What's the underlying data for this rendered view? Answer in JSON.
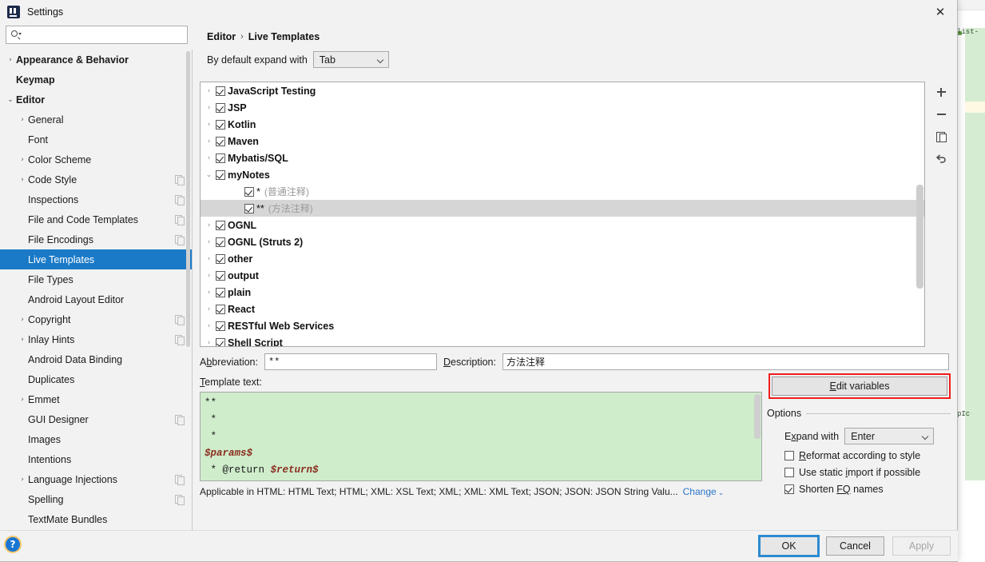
{
  "dialog": {
    "title": "Settings",
    "app_icon": "intellij-idea-icon",
    "close_icon": "✕"
  },
  "search": {
    "value": "",
    "placeholder": ""
  },
  "sidebar": {
    "items": [
      {
        "label": "Appearance & Behavior",
        "arrow": "›",
        "bold": true,
        "indent": 0,
        "selected": false,
        "copy": false
      },
      {
        "label": "Keymap",
        "arrow": "",
        "bold": true,
        "indent": 0,
        "selected": false,
        "copy": false
      },
      {
        "label": "Editor",
        "arrow": "⌄",
        "bold": true,
        "indent": 0,
        "selected": false,
        "copy": false
      },
      {
        "label": "General",
        "arrow": "›",
        "bold": false,
        "indent": 1,
        "selected": false,
        "copy": false
      },
      {
        "label": "Font",
        "arrow": "",
        "bold": false,
        "indent": 1,
        "selected": false,
        "copy": false
      },
      {
        "label": "Color Scheme",
        "arrow": "›",
        "bold": false,
        "indent": 1,
        "selected": false,
        "copy": false
      },
      {
        "label": "Code Style",
        "arrow": "›",
        "bold": false,
        "indent": 1,
        "selected": false,
        "copy": true
      },
      {
        "label": "Inspections",
        "arrow": "",
        "bold": false,
        "indent": 1,
        "selected": false,
        "copy": true
      },
      {
        "label": "File and Code Templates",
        "arrow": "",
        "bold": false,
        "indent": 1,
        "selected": false,
        "copy": true
      },
      {
        "label": "File Encodings",
        "arrow": "",
        "bold": false,
        "indent": 1,
        "selected": false,
        "copy": true
      },
      {
        "label": "Live Templates",
        "arrow": "",
        "bold": false,
        "indent": 1,
        "selected": true,
        "copy": false
      },
      {
        "label": "File Types",
        "arrow": "",
        "bold": false,
        "indent": 1,
        "selected": false,
        "copy": false
      },
      {
        "label": "Android Layout Editor",
        "arrow": "",
        "bold": false,
        "indent": 1,
        "selected": false,
        "copy": false
      },
      {
        "label": "Copyright",
        "arrow": "›",
        "bold": false,
        "indent": 1,
        "selected": false,
        "copy": true
      },
      {
        "label": "Inlay Hints",
        "arrow": "›",
        "bold": false,
        "indent": 1,
        "selected": false,
        "copy": true
      },
      {
        "label": "Android Data Binding",
        "arrow": "",
        "bold": false,
        "indent": 1,
        "selected": false,
        "copy": false
      },
      {
        "label": "Duplicates",
        "arrow": "",
        "bold": false,
        "indent": 1,
        "selected": false,
        "copy": false
      },
      {
        "label": "Emmet",
        "arrow": "›",
        "bold": false,
        "indent": 1,
        "selected": false,
        "copy": false
      },
      {
        "label": "GUI Designer",
        "arrow": "",
        "bold": false,
        "indent": 1,
        "selected": false,
        "copy": true
      },
      {
        "label": "Images",
        "arrow": "",
        "bold": false,
        "indent": 1,
        "selected": false,
        "copy": false
      },
      {
        "label": "Intentions",
        "arrow": "",
        "bold": false,
        "indent": 1,
        "selected": false,
        "copy": false
      },
      {
        "label": "Language Injections",
        "arrow": "›",
        "bold": false,
        "indent": 1,
        "selected": false,
        "copy": true
      },
      {
        "label": "Spelling",
        "arrow": "",
        "bold": false,
        "indent": 1,
        "selected": false,
        "copy": true
      },
      {
        "label": "TextMate Bundles",
        "arrow": "",
        "bold": false,
        "indent": 1,
        "selected": false,
        "copy": false
      }
    ]
  },
  "breadcrumb": {
    "parent": "Editor",
    "separator": "›",
    "current": "Live Templates"
  },
  "expand_default": {
    "label": "By default expand with",
    "value": "Tab"
  },
  "tree": {
    "rows": [
      {
        "label": "JavaScript Testing",
        "desc": "",
        "twisty": "›",
        "checked": true,
        "level": 0,
        "selected": false
      },
      {
        "label": "JSP",
        "desc": "",
        "twisty": "›",
        "checked": true,
        "level": 0,
        "selected": false
      },
      {
        "label": "Kotlin",
        "desc": "",
        "twisty": "›",
        "checked": true,
        "level": 0,
        "selected": false
      },
      {
        "label": "Maven",
        "desc": "",
        "twisty": "›",
        "checked": true,
        "level": 0,
        "selected": false
      },
      {
        "label": "Mybatis/SQL",
        "desc": "",
        "twisty": "›",
        "checked": true,
        "level": 0,
        "selected": false
      },
      {
        "label": "myNotes",
        "desc": "",
        "twisty": "⌄",
        "checked": true,
        "level": 0,
        "selected": false
      },
      {
        "label": "*",
        "desc": "(普通注释)",
        "twisty": "",
        "checked": true,
        "level": 1,
        "selected": false
      },
      {
        "label": "**",
        "desc": "(方法注释)",
        "twisty": "",
        "checked": true,
        "level": 1,
        "selected": true
      },
      {
        "label": "OGNL",
        "desc": "",
        "twisty": "›",
        "checked": true,
        "level": 0,
        "selected": false
      },
      {
        "label": "OGNL (Struts 2)",
        "desc": "",
        "twisty": "›",
        "checked": true,
        "level": 0,
        "selected": false
      },
      {
        "label": "other",
        "desc": "",
        "twisty": "›",
        "checked": true,
        "level": 0,
        "selected": false
      },
      {
        "label": "output",
        "desc": "",
        "twisty": "›",
        "checked": true,
        "level": 0,
        "selected": false
      },
      {
        "label": "plain",
        "desc": "",
        "twisty": "›",
        "checked": true,
        "level": 0,
        "selected": false
      },
      {
        "label": "React",
        "desc": "",
        "twisty": "›",
        "checked": true,
        "level": 0,
        "selected": false
      },
      {
        "label": "RESTful Web Services",
        "desc": "",
        "twisty": "›",
        "checked": true,
        "level": 0,
        "selected": false
      },
      {
        "label": "Shell Script",
        "desc": "",
        "twisty": "›",
        "checked": true,
        "level": 0,
        "selected": false
      }
    ]
  },
  "tree_tools": [
    {
      "name": "add-template-button",
      "icon": "plus-icon"
    },
    {
      "name": "remove-template-button",
      "icon": "minus-icon"
    },
    {
      "name": "duplicate-template-button",
      "icon": "copy-icon"
    },
    {
      "name": "revert-template-button",
      "icon": "revert-icon"
    }
  ],
  "abbreviation": {
    "label_pre": "A",
    "label_under": "b",
    "label_post": "breviation:",
    "value": "**"
  },
  "description": {
    "label_under": "D",
    "label_post": "escription:",
    "value": "方法注释"
  },
  "template_text": {
    "label_under": "T",
    "label_post": "emplate text:",
    "lines": [
      {
        "text": "**",
        "var": ""
      },
      {
        "text": " *",
        "var": ""
      },
      {
        "text": " *",
        "var": ""
      },
      {
        "text": "",
        "var": "$params$"
      },
      {
        "text": " * @return ",
        "var": "$return$"
      }
    ],
    "background_color": "#cfeccb",
    "variable_color": "#8b2d1e"
  },
  "applicable": {
    "text": "Applicable in HTML: HTML Text; HTML; XML: XSL Text; XML; XML: XML Text; JSON; JSON: JSON String Valu...",
    "change_label": "Change",
    "change_chevron": "⌄"
  },
  "edit_variables": {
    "label_under": "E",
    "label_post": "dit variables",
    "highlight_color": "#f01c1c"
  },
  "options": {
    "legend": "Options",
    "expand_with": {
      "label_pre": "E",
      "label_under": "x",
      "label_post": "pand with",
      "value": "Enter"
    },
    "checkboxes": [
      {
        "pre": "",
        "under": "R",
        "post": "eformat according to style",
        "checked": false
      },
      {
        "pre": "Use static ",
        "under": "i",
        "post": "mport if possible",
        "checked": false
      },
      {
        "pre": "Shorten ",
        "under": "FQ",
        "post": " names",
        "checked": true
      }
    ]
  },
  "footer": {
    "help_icon": "?",
    "ok": "OK",
    "cancel": "Cancel",
    "apply": "Apply"
  },
  "background_ide": {
    "snippet_top": "list-",
    "snippet_mid": "pIc",
    "toolbar_colors": [
      "#4a9e4a",
      "#6a6a6a",
      "#8a8a8a",
      "#9a9a9a",
      "#7a7a7a",
      "#8a8a8a",
      "#6a8ab0",
      "#5a5a5a",
      "#7a7a7a",
      "#6a6a6a",
      "#5a7a9a",
      "#8a8a8a",
      "#3a6ea5",
      "#9a9a9a",
      "#6a6a6a",
      "#4a6a9a",
      "#c04a2a"
    ]
  }
}
